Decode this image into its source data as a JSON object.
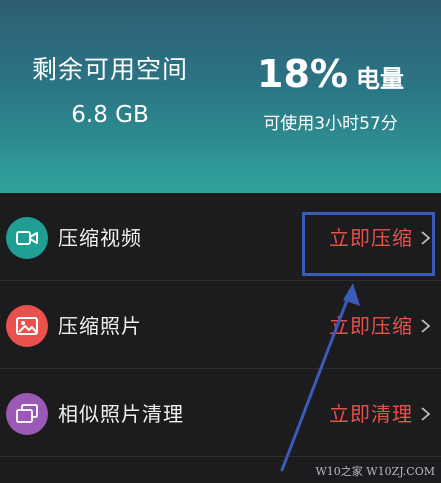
{
  "header": {
    "storage_title": "剩余可用空间",
    "storage_value": "6.8 GB",
    "battery_percent": "18%",
    "battery_label": "电量",
    "battery_remaining": "可使用3小时57分"
  },
  "rows": [
    {
      "label": "压缩视频",
      "action": "立即压缩",
      "icon": "video-camera-icon",
      "icon_color": "#1f9f94"
    },
    {
      "label": "压缩照片",
      "action": "立即压缩",
      "icon": "image-icon",
      "icon_color": "#e9524c"
    },
    {
      "label": "相似照片清理",
      "action": "立即清理",
      "icon": "stacked-photos-icon",
      "icon_color": "#9b59b6"
    }
  ],
  "colors": {
    "action_text": "#e5524a",
    "highlight_box": "#3a5bb8",
    "annotation_arrow": "#3a5bb8"
  },
  "watermark": "W10之家 W10ZJ.COM"
}
